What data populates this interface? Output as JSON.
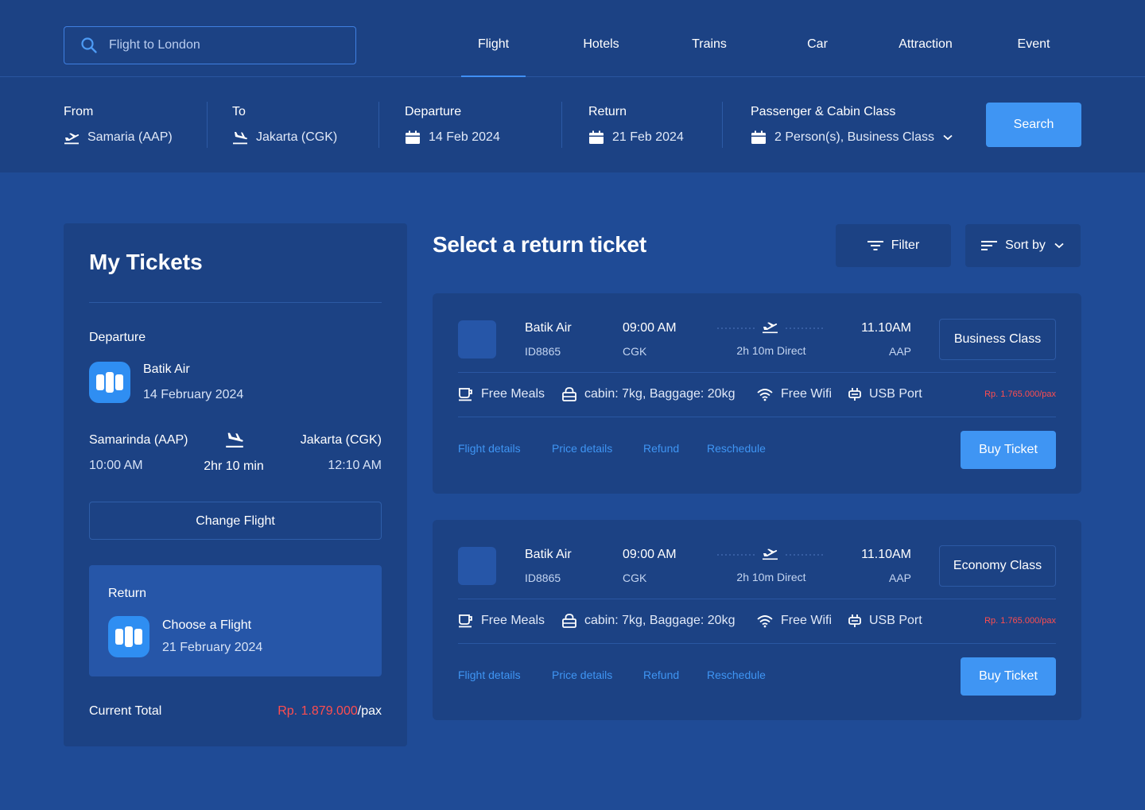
{
  "header": {
    "search_placeholder": "Flight to London",
    "nav": [
      "Flight",
      "Hotels",
      "Trains",
      "Car",
      "Attraction",
      "Event"
    ]
  },
  "filters": {
    "from_label": "From",
    "from_value": "Samaria (AAP)",
    "to_label": "To",
    "to_value": "Jakarta (CGK)",
    "departure_label": "Departure",
    "departure_value": "14 Feb 2024",
    "return_label": "Return",
    "return_value": "21 Feb 2024",
    "passenger_label": "Passenger & Cabin Class",
    "passenger_value": "2 Person(s), Business Class",
    "search_button": "Search"
  },
  "my_tickets": {
    "title": "My Tickets",
    "departure_label": "Departure",
    "departure_airline": "Batik Air",
    "departure_date": "14 February 2024",
    "origin": "Samarinda (AAP)",
    "destination": "Jakarta (CGK)",
    "dep_time": "10:00 AM",
    "duration": "2hr 10 min",
    "arr_time": "12:10 AM",
    "change_button": "Change Flight",
    "return_label": "Return",
    "return_prompt": "Choose a Flight",
    "return_date": "21 February 2024",
    "total_label": "Current Total",
    "total_price": "Rp. 1.879.000",
    "total_unit": "/pax"
  },
  "results": {
    "title": "Select a return ticket",
    "filter_button": "Filter",
    "sort_button": "Sort by",
    "tickets": [
      {
        "airline": "Batik Air",
        "code": "ID8865",
        "dep_time": "09:00 AM",
        "dep_iata": "CGK",
        "duration": "2h 10m Direct",
        "arr_time": "11.10AM",
        "arr_iata": "AAP",
        "class": "Business Class",
        "amenities": [
          "Free Meals",
          "cabin: 7kg, Baggage: 20kg",
          "Free Wifi",
          "USB Port"
        ],
        "price": "Rp. 1.765.000/pax",
        "links": [
          "Flight details",
          "Price details",
          "Refund",
          "Reschedule"
        ],
        "buy": "Buy Ticket"
      },
      {
        "airline": "Batik Air",
        "code": "ID8865",
        "dep_time": "09:00 AM",
        "dep_iata": "CGK",
        "duration": "2h 10m Direct",
        "arr_time": "11.10AM",
        "arr_iata": "AAP",
        "class": "Economy Class",
        "amenities": [
          "Free Meals",
          "cabin: 7kg, Baggage: 20kg",
          "Free Wifi",
          "USB Port"
        ],
        "price": "Rp. 1.765.000/pax",
        "links": [
          "Flight details",
          "Price details",
          "Refund",
          "Reschedule"
        ],
        "buy": "Buy Ticket"
      }
    ]
  },
  "colors": {
    "accent": "#3f95f3",
    "price": "#ff4d4f",
    "background": "#1f4b96",
    "panel": "#1c4284"
  }
}
